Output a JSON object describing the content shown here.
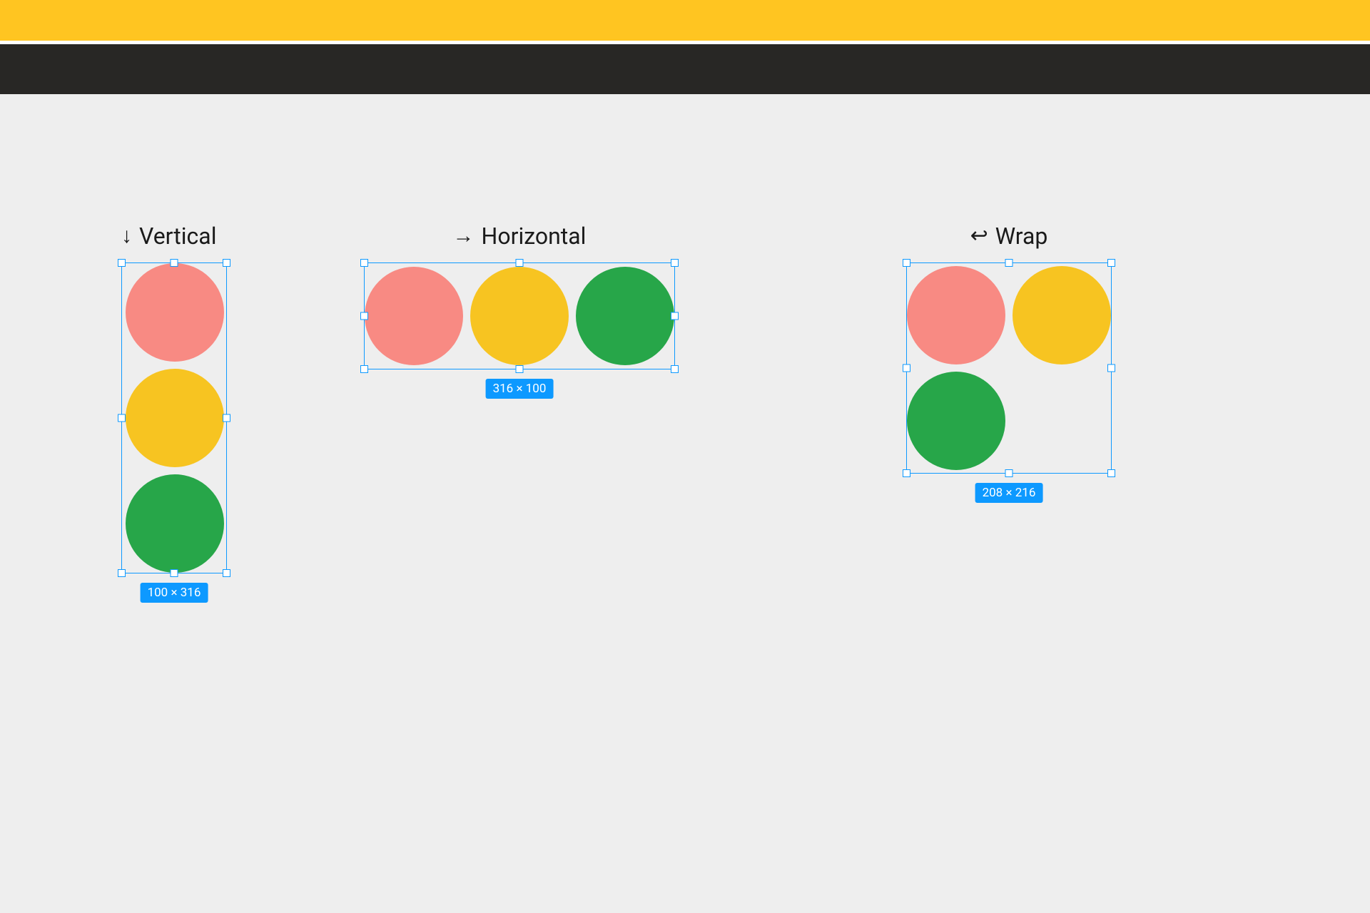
{
  "examples": {
    "vertical": {
      "label": "Vertical",
      "icon": "↓",
      "dimensions": "100 × 316"
    },
    "horizontal": {
      "label": "Horizontal",
      "icon": "→",
      "dimensions": "316 × 100"
    },
    "wrap": {
      "label": "Wrap",
      "icon": "↩",
      "dimensions": "208 × 216"
    }
  },
  "colors": {
    "red": "#f88a83",
    "yellow": "#f7c421",
    "green": "#27a649",
    "selection": "#0d99ff",
    "barYellow": "#ffc521",
    "barBlack": "#282725"
  }
}
